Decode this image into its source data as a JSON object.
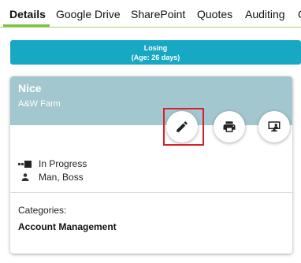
{
  "tabs": [
    {
      "label": "Details"
    },
    {
      "label": "Google Drive"
    },
    {
      "label": "SharePoint"
    },
    {
      "label": "Quotes"
    },
    {
      "label": "Auditing"
    },
    {
      "label": "C"
    }
  ],
  "banner": {
    "line1": "Losing",
    "line2": "(Age: 26 days)"
  },
  "card": {
    "title": "Nice",
    "subtitle": "A&W Farm",
    "actions": {
      "edit_icon": "pencil-icon",
      "print_icon": "printer-icon",
      "desktop_icon": "desktop-user-icon"
    },
    "status": "In Progress",
    "owner": "Man, Boss",
    "categories_label": "Categories:",
    "category": "Account Management"
  },
  "colors": {
    "tab_accent": "#7cc243",
    "banner": "#17a8c4",
    "card_header": "#a3c7cf",
    "highlight": "#d6202a"
  }
}
